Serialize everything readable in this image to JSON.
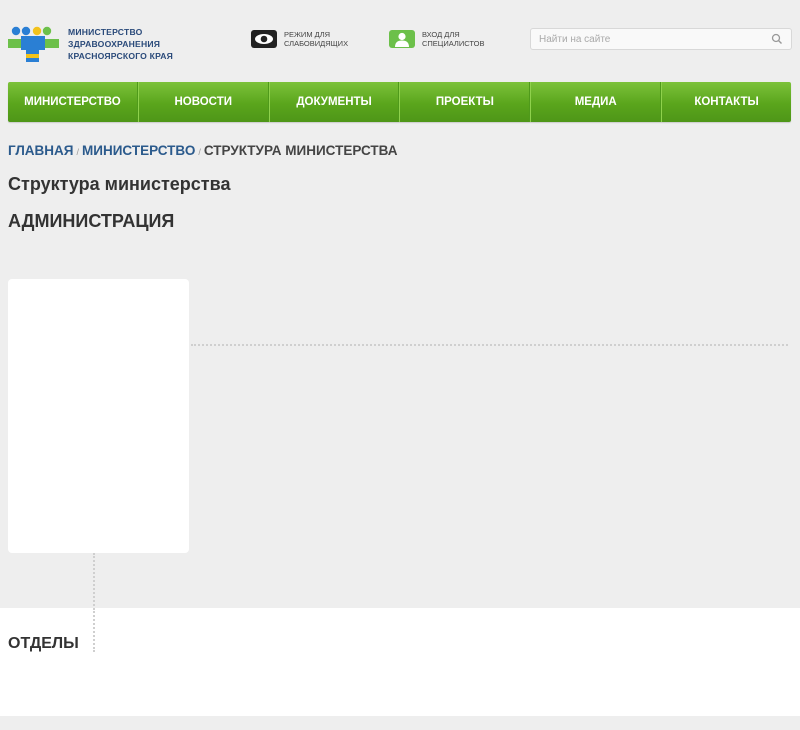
{
  "header": {
    "logo_lines": [
      "МИНИСТЕРСТВО",
      "ЗДРАВООХРАНЕНИЯ",
      "КРАСНОЯРСКОГО КРАЯ"
    ],
    "low_vision": {
      "label": "РЕЖИМ ДЛЯ\nСЛАБОВИДЯЩИХ",
      "icon": "eye-icon"
    },
    "specialists": {
      "label": "ВХОД ДЛЯ\nСПЕЦИАЛИСТОВ",
      "icon": "user-icon"
    },
    "search": {
      "placeholder": "Найти на сайте",
      "value": "",
      "icon": "search-icon"
    }
  },
  "nav": {
    "items": [
      "МИНИСТЕРСТВО",
      "НОВОСТИ",
      "ДОКУМЕНТЫ",
      "ПРОЕКТЫ",
      "МЕДИА",
      "КОНТАКТЫ"
    ]
  },
  "breadcrumb": {
    "items": [
      "ГЛАВНАЯ",
      "МИНИСТЕРСТВО"
    ],
    "separator": "/",
    "current": "СТРУКТУРА МИНИСТЕРСТВА"
  },
  "page": {
    "title": "Структура министерства",
    "admin_heading": "АДМИНИСТРАЦИЯ",
    "depts_heading": "ОТДЕЛЫ"
  },
  "colors": {
    "nav_green": "#5aa51c",
    "link_blue": "#2b5a8c",
    "logo_blue": "#2a7fd4",
    "logo_yellow": "#f2c21b",
    "logo_green": "#6cc04a"
  }
}
